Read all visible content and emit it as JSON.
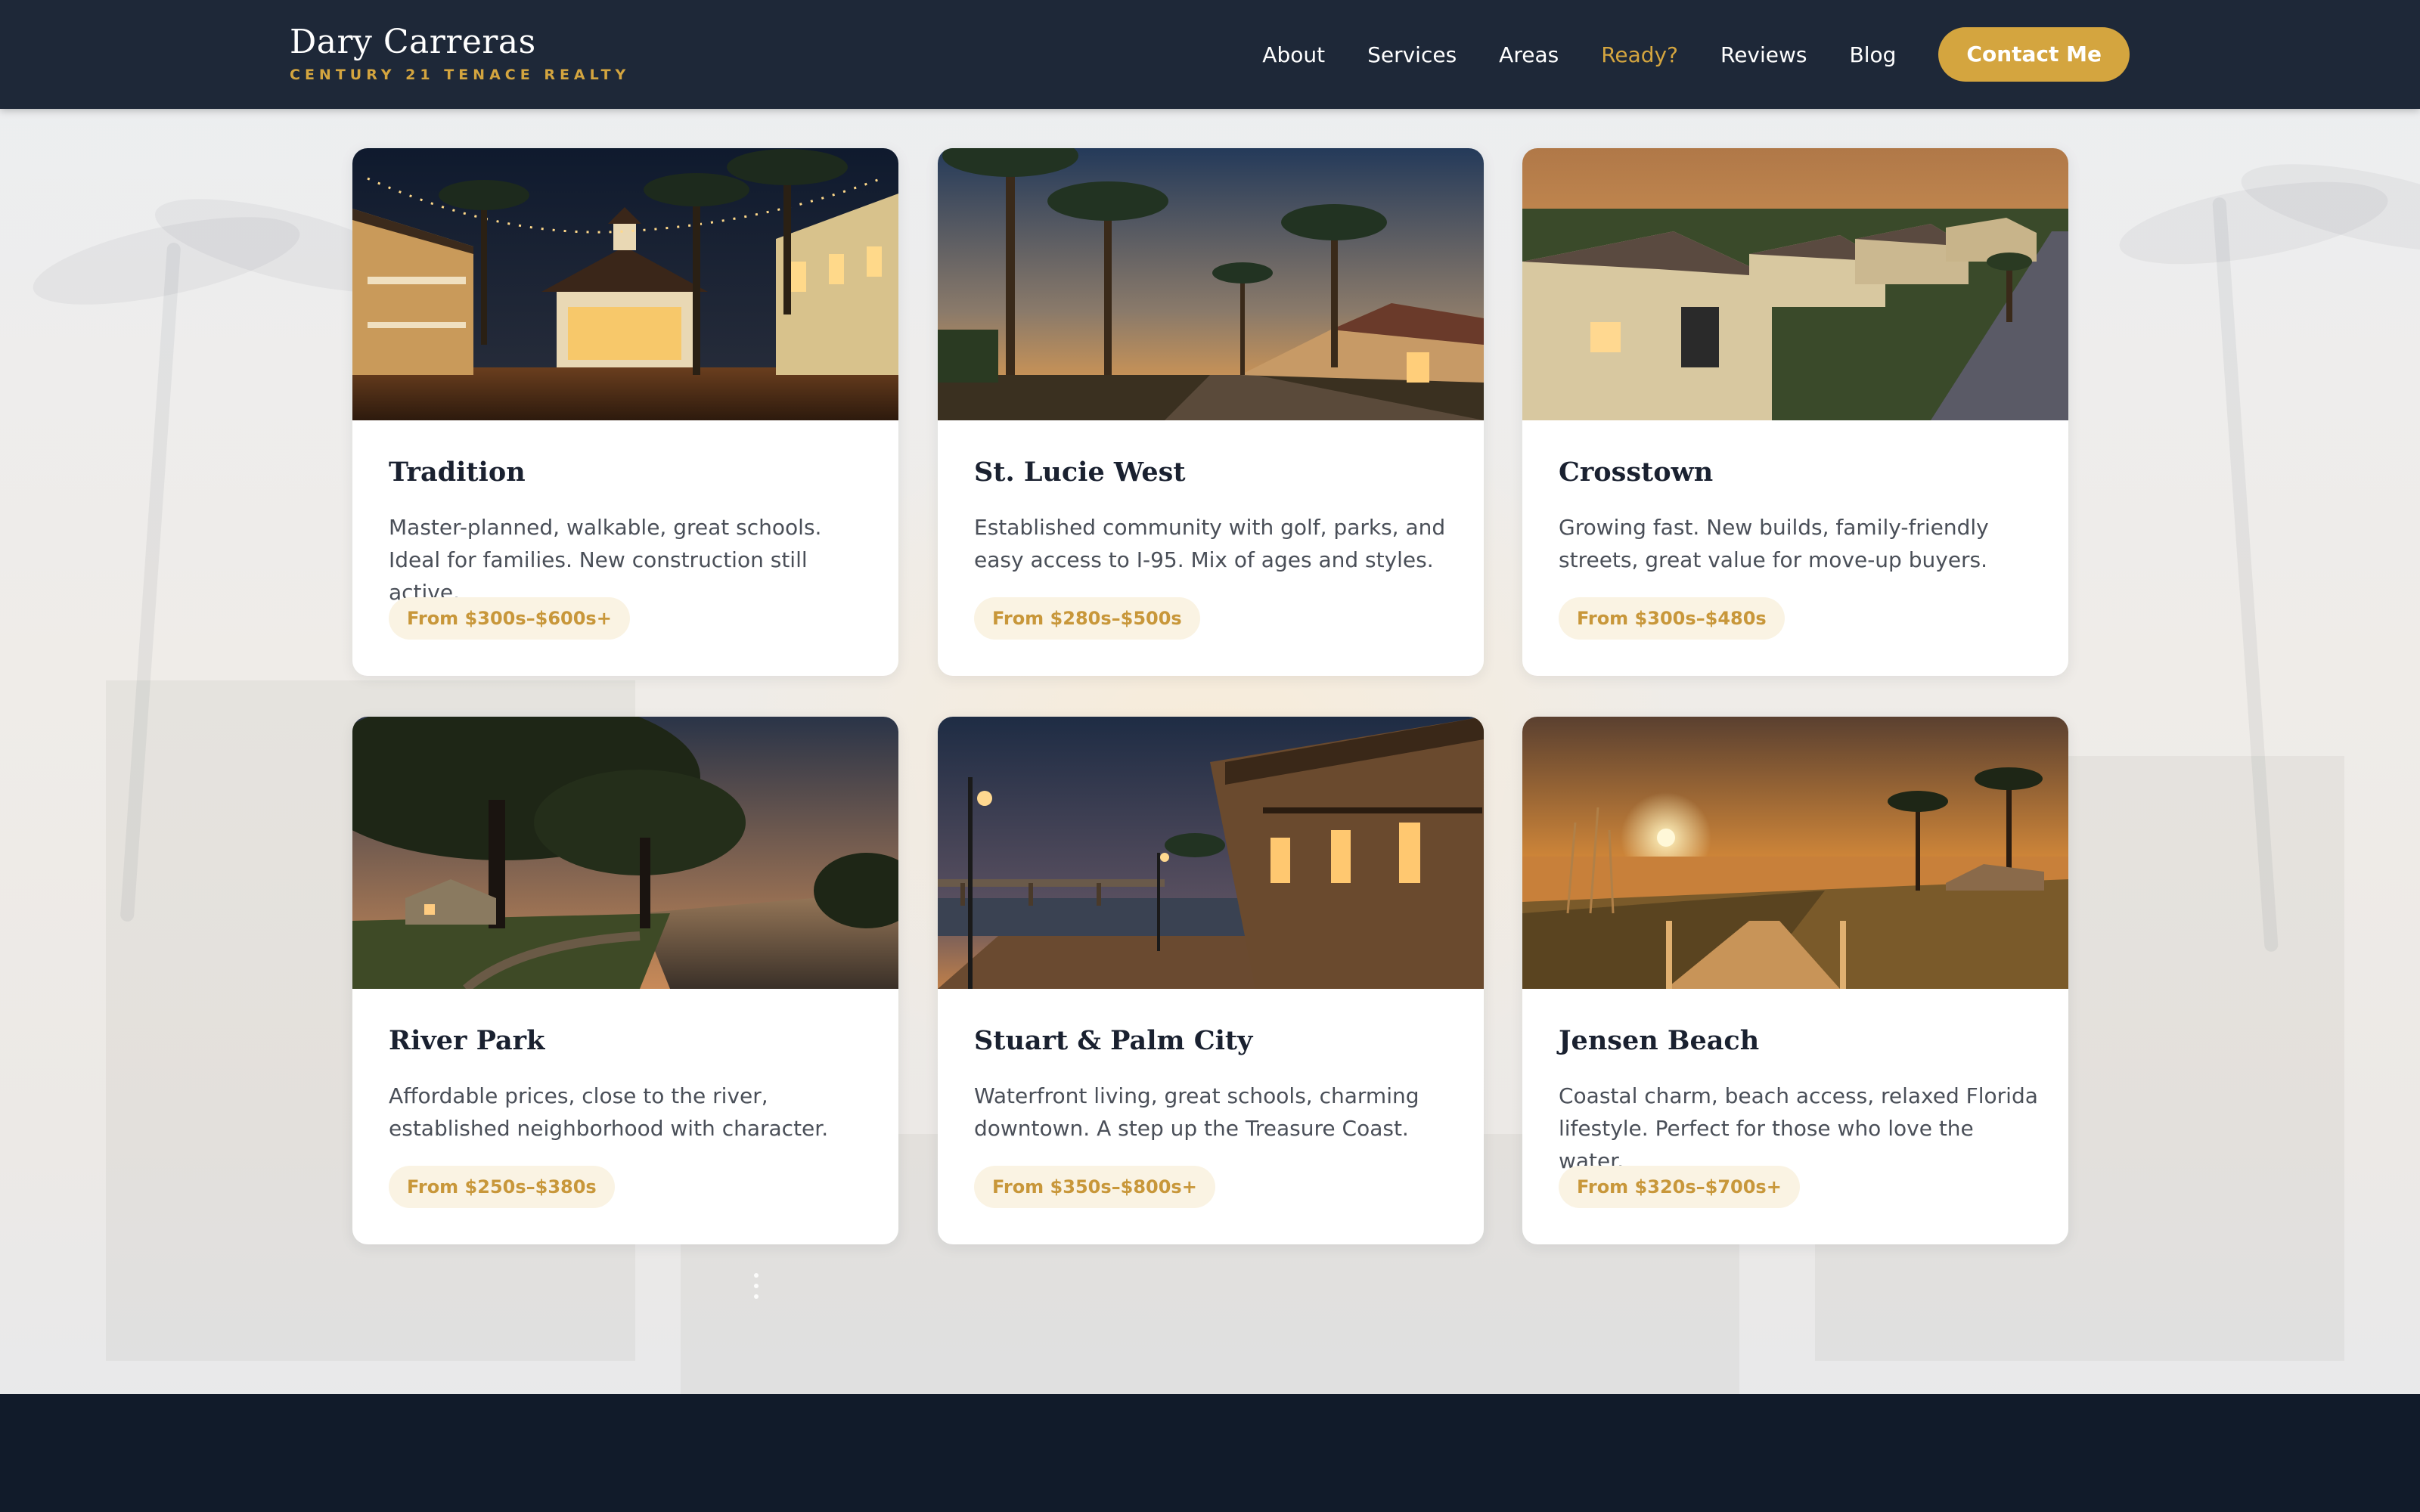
{
  "brand": {
    "name": "Dary Carreras",
    "tagline": "CENTURY 21 TENACE REALTY"
  },
  "nav": {
    "items": [
      {
        "label": "About"
      },
      {
        "label": "Services"
      },
      {
        "label": "Areas"
      },
      {
        "label": "Ready?",
        "active": true
      },
      {
        "label": "Reviews"
      },
      {
        "label": "Blog"
      }
    ],
    "cta": "Contact Me"
  },
  "areas": [
    {
      "title": "Tradition",
      "description": "Master-planned, walkable, great schools. Ideal for families. New construction still active.",
      "price": "From $300s–$600s+",
      "image": "gazebo-night"
    },
    {
      "title": "St. Lucie West",
      "description": "Established community with golf, parks, and easy access to I-95. Mix of ages and styles.",
      "price": "From $280s–$500s",
      "image": "palm-street-dusk"
    },
    {
      "title": "Crosstown",
      "description": "Growing fast. New builds, family-friendly streets, great value for move-up buyers.",
      "price": "From $300s–$480s",
      "image": "suburb-sunset"
    },
    {
      "title": "River Park",
      "description": "Affordable prices, close to the river, established neighborhood with character.",
      "price": "From $250s–$380s",
      "image": "river-oaks-dusk"
    },
    {
      "title": "Stuart & Palm City",
      "description": "Waterfront living, great schools, charming downtown. A step up the Treasure Coast.",
      "price": "From $350s–$800s+",
      "image": "waterfront-downtown"
    },
    {
      "title": "Jensen Beach",
      "description": "Coastal charm, beach access, relaxed Florida lifestyle. Perfect for those who love the water.",
      "price": "From $320s–$700s+",
      "image": "beach-boardwalk-sunset"
    }
  ],
  "colors": {
    "header_bg": "#1e2838",
    "accent": "#d4a53f",
    "footer_bg": "#111b2a"
  }
}
